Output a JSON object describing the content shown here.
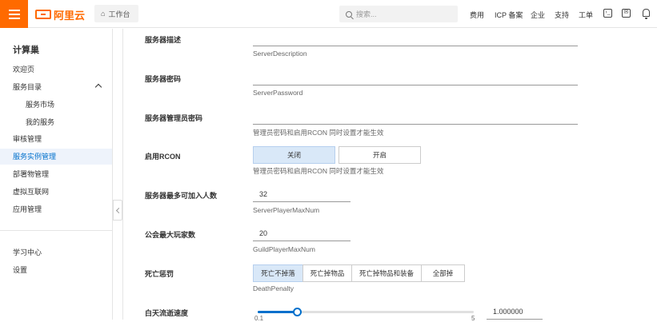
{
  "header": {
    "logo_text": "阿里云",
    "workbench_label": "工作台",
    "search_placeholder": "搜索...",
    "nav": [
      "费用",
      "ICP 备案",
      "企业",
      "支持",
      "工单"
    ]
  },
  "sidebar": {
    "title": "计算巢",
    "items": [
      {
        "label": "欢迎页"
      },
      {
        "label": "服务目录"
      },
      {
        "label": "服务市场"
      },
      {
        "label": "我的服务"
      },
      {
        "label": "审核管理"
      },
      {
        "label": "服务实例管理"
      },
      {
        "label": "部署物管理"
      },
      {
        "label": "虚拟互联网"
      },
      {
        "label": "应用管理"
      },
      {
        "label": "学习中心"
      },
      {
        "label": "设置"
      }
    ]
  },
  "form": {
    "server_description": {
      "label": "服务器描述",
      "help": "ServerDescription"
    },
    "server_password": {
      "label": "服务器密码",
      "help": "ServerPassword"
    },
    "admin_password": {
      "label": "服务器管理员密码",
      "help": "管理员密码和启用RCON 同时设置才能生效"
    },
    "enable_rcon": {
      "label": "启用RCON",
      "options": [
        "关闭",
        "开启"
      ],
      "selected": "关闭",
      "help": "管理员密码和启用RCON 同时设置才能生效"
    },
    "max_players": {
      "label": "服务器最多可加入人数",
      "value": "32",
      "help": "ServerPlayerMaxNum"
    },
    "guild_max": {
      "label": "公会最大玩家数",
      "value": "20",
      "help": "GuildPlayerMaxNum"
    },
    "death_penalty": {
      "label": "死亡惩罚",
      "options": [
        "死亡不掉落",
        "死亡掉物品",
        "死亡掉物品和装备",
        "全部掉"
      ],
      "selected": "死亡不掉落",
      "help": "DeathPenalty"
    },
    "day_speed": {
      "label": "白天流逝速度",
      "value": "1.000000",
      "slider_fraction": 0.18,
      "min_label": "0.1",
      "max_label": "5"
    }
  }
}
